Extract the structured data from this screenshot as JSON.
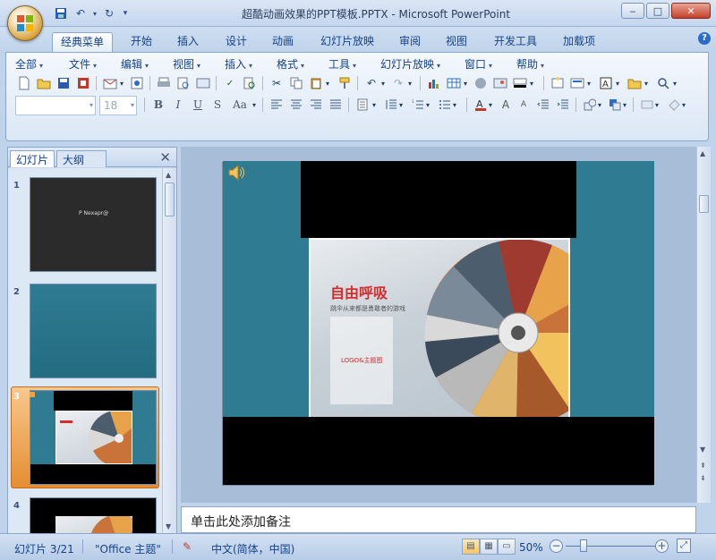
{
  "window": {
    "title": "超酷动画效果的PPT模板.PPTX - Microsoft PowerPoint",
    "min": "‒",
    "max": "□",
    "close": "✕"
  },
  "tabs": [
    {
      "label": "经典菜单",
      "active": true
    },
    {
      "label": "开始"
    },
    {
      "label": "插入"
    },
    {
      "label": "设计"
    },
    {
      "label": "动画"
    },
    {
      "label": "幻灯片放映"
    },
    {
      "label": "审阅"
    },
    {
      "label": "视图"
    },
    {
      "label": "开发工具"
    },
    {
      "label": "加载项"
    }
  ],
  "menus": [
    "全部",
    "文件",
    "编辑",
    "视图",
    "插入",
    "格式",
    "工具",
    "幻灯片放映",
    "窗口",
    "帮助"
  ],
  "format": {
    "font_name": "",
    "font_size": "18",
    "bold": "B",
    "italic": "I",
    "underline": "U",
    "strike": "S",
    "case": "Aa"
  },
  "panel": {
    "tab_slides": "幻灯片",
    "tab_outline": "大纲",
    "close": "✕",
    "thumbs": [
      {
        "num": "1",
        "label": "P Nexapr@"
      },
      {
        "num": "2"
      },
      {
        "num": "3"
      },
      {
        "num": "4"
      }
    ]
  },
  "slide": {
    "title": "自由呼吸",
    "subtitle": "跳伞从来都是勇敢者的游戏",
    "logo": "LOGO&主题图"
  },
  "notes": {
    "placeholder": "单击此处添加备注"
  },
  "status": {
    "slide_info": "幻灯片 3/21",
    "theme": "\"Office 主题\"",
    "language": "中文(简体，中国)",
    "zoom": "50%",
    "zoom_out": "−",
    "zoom_in": "+"
  }
}
